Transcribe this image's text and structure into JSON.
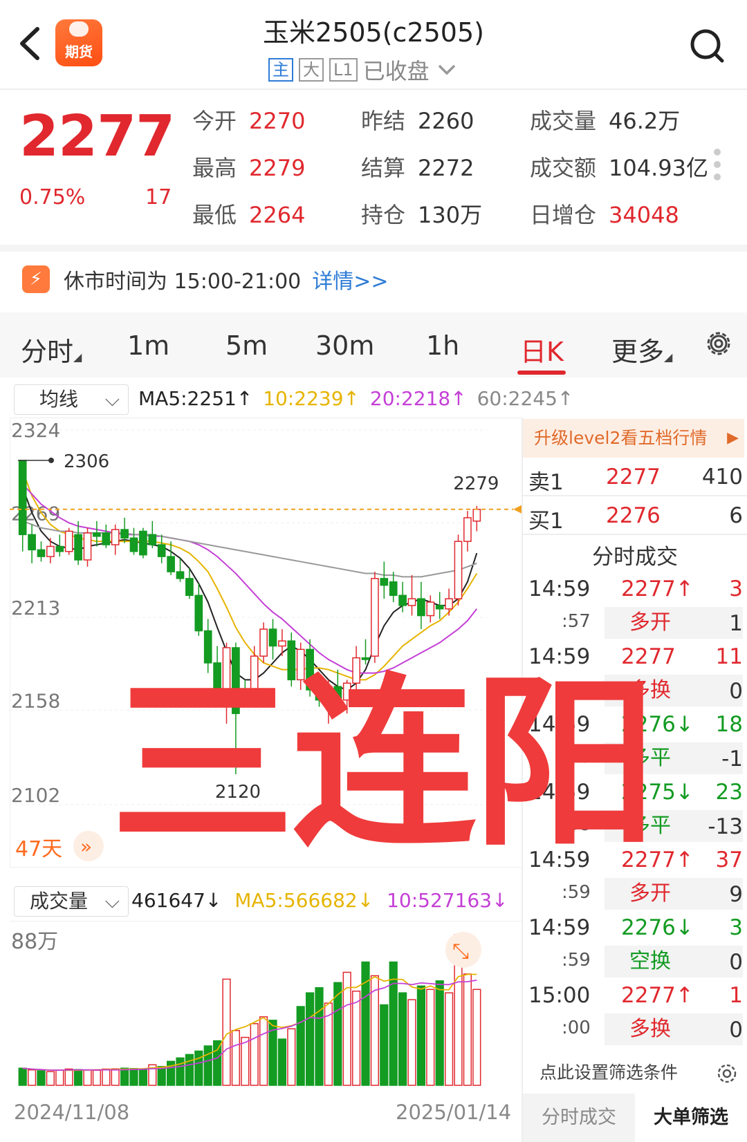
{
  "header": {
    "title": "玉米2505(c2505)",
    "badges": [
      "主",
      "大",
      "L1"
    ],
    "status": "已收盘",
    "logo_text": "期货"
  },
  "quote": {
    "price": "2277",
    "change_pct": "0.75%",
    "change": "17",
    "fields": [
      {
        "label": "今开",
        "value": "2270",
        "color": "red"
      },
      {
        "label": "昨结",
        "value": "2260",
        "color": "dark"
      },
      {
        "label": "成交量",
        "value": "46.2万",
        "color": "dark"
      },
      {
        "label": "最高",
        "value": "2279",
        "color": "red"
      },
      {
        "label": "结算",
        "value": "2272",
        "color": "dark"
      },
      {
        "label": "成交额",
        "value": "104.93亿",
        "color": "dark"
      },
      {
        "label": "最低",
        "value": "2264",
        "color": "red"
      },
      {
        "label": "持仓",
        "value": "130万",
        "color": "dark"
      },
      {
        "label": "日增仓",
        "value": "34048",
        "color": "red"
      }
    ]
  },
  "notice": {
    "text": "休市时间为 15:00-21:00",
    "link": "详情>>"
  },
  "tabs": [
    {
      "label": "分时",
      "dropdown": true
    },
    {
      "label": "1m"
    },
    {
      "label": "5m"
    },
    {
      "label": "30m"
    },
    {
      "label": "1h"
    },
    {
      "label": "日K",
      "active": true
    },
    {
      "label": "更多",
      "dropdown": true
    }
  ],
  "ma": {
    "selector": "均线",
    "ma5": "MA5:2251↑",
    "ma10": "10:2239↑",
    "ma20": "20:2218↑",
    "ma60": "60:2245↑"
  },
  "chart_labels": {
    "y_ticks": [
      "2324",
      "2269",
      "2213",
      "2158",
      "2102"
    ],
    "max_marker": "2306",
    "min_marker": "2120",
    "last_high": "2279",
    "days": "47天"
  },
  "chart_data": {
    "type": "candlestick",
    "x_start": "2024/11/08",
    "x_end": "2025/01/14",
    "ylim": [
      2102,
      2324
    ],
    "candles": [
      [
        2306,
        2301,
        2252,
        2262
      ],
      [
        2262,
        2268,
        2245,
        2253
      ],
      [
        2253,
        2258,
        2246,
        2249
      ],
      [
        2249,
        2260,
        2245,
        2255
      ],
      [
        2255,
        2262,
        2249,
        2252
      ],
      [
        2252,
        2266,
        2250,
        2264
      ],
      [
        2262,
        2270,
        2244,
        2247
      ],
      [
        2247,
        2266,
        2243,
        2263
      ],
      [
        2263,
        2270,
        2255,
        2261
      ],
      [
        2263,
        2268,
        2254,
        2256
      ],
      [
        2256,
        2268,
        2250,
        2265
      ],
      [
        2265,
        2272,
        2257,
        2260
      ],
      [
        2260,
        2266,
        2250,
        2252
      ],
      [
        2264,
        2266,
        2248,
        2250
      ],
      [
        2262,
        2270,
        2254,
        2256
      ],
      [
        2256,
        2262,
        2245,
        2249
      ],
      [
        2249,
        2258,
        2238,
        2240
      ],
      [
        2240,
        2248,
        2234,
        2236
      ],
      [
        2236,
        2242,
        2224,
        2226
      ],
      [
        2226,
        2233,
        2202,
        2205
      ],
      [
        2205,
        2212,
        2180,
        2186
      ],
      [
        2186,
        2196,
        2168,
        2170
      ],
      [
        2166,
        2198,
        2150,
        2195
      ],
      [
        2195,
        2198,
        2120,
        2156
      ],
      [
        2170,
        2176,
        2164,
        2168
      ],
      [
        2170,
        2196,
        2168,
        2190
      ],
      [
        2190,
        2210,
        2186,
        2206
      ],
      [
        2206,
        2212,
        2188,
        2196
      ],
      [
        2196,
        2206,
        2190,
        2199
      ],
      [
        2199,
        2204,
        2172,
        2176
      ],
      [
        2176,
        2198,
        2170,
        2194
      ],
      [
        2194,
        2200,
        2166,
        2170
      ],
      [
        2170,
        2176,
        2160,
        2164
      ],
      [
        2164,
        2176,
        2150,
        2172
      ],
      [
        2172,
        2182,
        2158,
        2162
      ],
      [
        2164,
        2176,
        2156,
        2174
      ],
      [
        2174,
        2196,
        2170,
        2189
      ],
      [
        2189,
        2200,
        2185,
        2188
      ],
      [
        2190,
        2240,
        2186,
        2236
      ],
      [
        2236,
        2246,
        2224,
        2232
      ],
      [
        2234,
        2240,
        2222,
        2226
      ],
      [
        2226,
        2234,
        2216,
        2220
      ],
      [
        2220,
        2238,
        2214,
        2224
      ],
      [
        2224,
        2234,
        2206,
        2214
      ],
      [
        2214,
        2226,
        2210,
        2222
      ],
      [
        2220,
        2228,
        2212,
        2218
      ],
      [
        2218,
        2230,
        2214,
        2224
      ],
      [
        2224,
        2262,
        2220,
        2258
      ],
      [
        2258,
        2276,
        2252,
        2272
      ],
      [
        2270,
        2279,
        2264,
        2277
      ]
    ],
    "ma_series": {
      "MA5": [
        2290,
        2275,
        2264,
        2258,
        2255,
        2254,
        2253,
        2255,
        2256,
        2257,
        2258,
        2259,
        2258,
        2257,
        2256,
        2255,
        2252,
        2248,
        2242,
        2233,
        2222,
        2207,
        2193,
        2180,
        2176,
        2176,
        2180,
        2186,
        2192,
        2196,
        2193,
        2188,
        2182,
        2176,
        2172,
        2170,
        2174,
        2182,
        2196,
        2208,
        2216,
        2220,
        2222,
        2224,
        2222,
        2220,
        2220,
        2224,
        2234,
        2251
      ],
      "MA10": [
        2300,
        2285,
        2275,
        2268,
        2264,
        2262,
        2260,
        2259,
        2258,
        2258,
        2258,
        2258,
        2258,
        2258,
        2258,
        2257,
        2256,
        2254,
        2251,
        2246,
        2240,
        2230,
        2219,
        2207,
        2198,
        2191,
        2186,
        2184,
        2182,
        2182,
        2182,
        2183,
        2183,
        2182,
        2180,
        2178,
        2176,
        2176,
        2179,
        2184,
        2190,
        2196,
        2200,
        2204,
        2208,
        2211,
        2216,
        2222,
        2230,
        2239
      ],
      "MA20": [
        2292,
        2286,
        2280,
        2276,
        2272,
        2269,
        2267,
        2266,
        2265,
        2264,
        2263,
        2262,
        2262,
        2262,
        2261,
        2261,
        2260,
        2259,
        2258,
        2256,
        2253,
        2249,
        2244,
        2239,
        2233,
        2227,
        2221,
        2216,
        2212,
        2207,
        2202,
        2197,
        2192,
        2188,
        2185,
        2182,
        2180,
        2180,
        2180,
        2181,
        2183,
        2186,
        2189,
        2192,
        2195,
        2198,
        2202,
        2206,
        2211,
        2218
      ],
      "MA60": [
        2270,
        2268,
        2266,
        2265,
        2264,
        2264,
        2263,
        2263,
        2263,
        2263,
        2263,
        2263,
        2262,
        2262,
        2262,
        2261,
        2260,
        2259,
        2258,
        2257,
        2256,
        2255,
        2254,
        2253,
        2252,
        2251,
        2250,
        2249,
        2248,
        2247,
        2246,
        2245,
        2244,
        2243,
        2242,
        2241,
        2240,
        2239,
        2239,
        2238,
        2238,
        2237,
        2237,
        2237,
        2238,
        2239,
        2240,
        2241,
        2243,
        2245
      ]
    },
    "volume": {
      "label": "成交量",
      "current": "461647↓",
      "ma5_label": "MA5:566682↓",
      "ma10_label": "10:527163↓",
      "ymax_label": "88万",
      "ymax": 880000,
      "values": [
        100000,
        90000,
        85000,
        80000,
        88000,
        95000,
        92000,
        90000,
        88000,
        95000,
        96000,
        100000,
        98000,
        96000,
        120000,
        110000,
        140000,
        160000,
        180000,
        200000,
        230000,
        260000,
        620000,
        320000,
        280000,
        360000,
        400000,
        380000,
        270000,
        330000,
        460000,
        540000,
        570000,
        480000,
        600000,
        660000,
        550000,
        720000,
        640000,
        470000,
        720000,
        540000,
        500000,
        580000,
        560000,
        610000,
        540000,
        880000,
        650000,
        560000
      ],
      "up": [
        false,
        true,
        false,
        true,
        true,
        true,
        false,
        true,
        true,
        true,
        true,
        false,
        false,
        false,
        true,
        false,
        false,
        false,
        false,
        false,
        false,
        false,
        true,
        true,
        true,
        true,
        true,
        false,
        false,
        true,
        false,
        false,
        false,
        true,
        false,
        true,
        true,
        false,
        true,
        false,
        false,
        false,
        true,
        false,
        true,
        false,
        true,
        true,
        true,
        true
      ]
    }
  },
  "orderbook": {
    "upgrade": "升级level2看五档行情",
    "sell1": {
      "label": "卖1",
      "price": "2277",
      "qty": "410"
    },
    "buy1": {
      "label": "买1",
      "price": "2276",
      "qty": "6"
    }
  },
  "ticks": {
    "title": "分时成交",
    "rows": [
      {
        "time": "14:59",
        "sub": ":57",
        "price": "2277↑",
        "dir": "up",
        "vol": "3",
        "type": "多开",
        "type_color": "red",
        "num": "1"
      },
      {
        "time": "14:59",
        "sub": ":57",
        "price": "2277",
        "dir": "up",
        "vol": "11",
        "type": "多换",
        "type_color": "red",
        "num": "0"
      },
      {
        "time": "14:59",
        "sub": ":58",
        "price": "2276↓",
        "dir": "down",
        "vol": "18",
        "type": "多平",
        "type_color": "green",
        "num": "-1"
      },
      {
        "time": "14:59",
        "sub": ":58",
        "price": "2275↓",
        "dir": "down",
        "vol": "23",
        "type": "多平",
        "type_color": "green",
        "num": "-13"
      },
      {
        "time": "14:59",
        "sub": ":59",
        "price": "2277↑",
        "dir": "up",
        "vol": "37",
        "type": "多开",
        "type_color": "red",
        "num": "9"
      },
      {
        "time": "14:59",
        "sub": ":59",
        "price": "2276↓",
        "dir": "down",
        "vol": "3",
        "type": "空换",
        "type_color": "green",
        "num": "0"
      },
      {
        "time": "15:00",
        "sub": ":00",
        "price": "2277↑",
        "dir": "up",
        "vol": "1",
        "type": "多换",
        "type_color": "red",
        "num": "0"
      }
    ],
    "filter_setting": "点此设置筛选条件",
    "bottom_tabs": [
      "分时成交",
      "大单筛选"
    ]
  },
  "dates": {
    "start": "2024/11/08",
    "end": "2025/01/14"
  },
  "overlay": "三连阳",
  "colors": {
    "up": "#e0282e",
    "down": "#139b22",
    "ma5": "#222222",
    "ma10": "#e6b400",
    "ma20": "#c43fd6",
    "ma60": "#999999",
    "accent": "#ff6a1f"
  }
}
